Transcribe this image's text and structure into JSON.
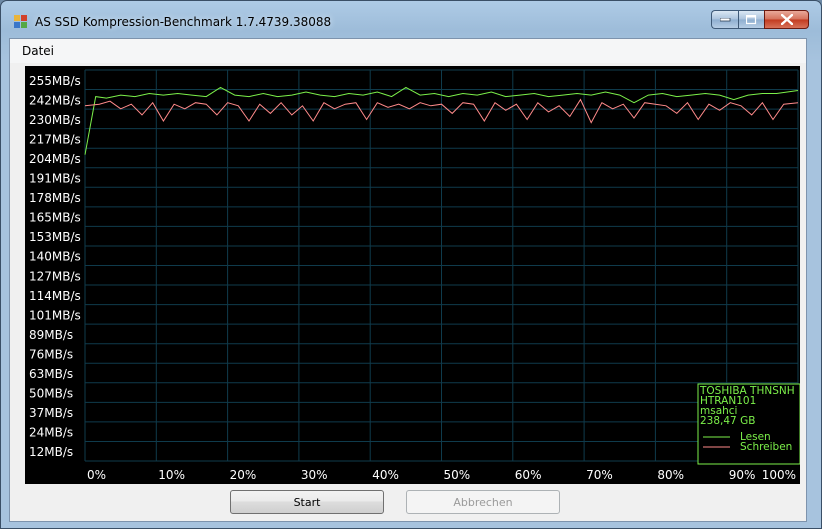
{
  "window": {
    "title": "AS SSD Kompression-Benchmark 1.7.4739.38088"
  },
  "menu": {
    "items": [
      "Datei"
    ]
  },
  "buttons": {
    "start": "Start",
    "cancel": "Abbrechen"
  },
  "colors": {
    "read": "#7cf04a",
    "write": "#ff8a8a",
    "grid": "#0f3b4c",
    "axis_text": "#ffffff",
    "info_text": "#7cf04a"
  },
  "info_box": {
    "lines": [
      "TOSHIBA THNSNH",
      "HTRAN101",
      "msahci",
      "238,47 GB"
    ],
    "legend_read": "Lesen",
    "legend_write": "Schreiben"
  },
  "chart_data": {
    "type": "line",
    "y_tick_labels": [
      "255MB/s",
      "242MB/s",
      "230MB/s",
      "217MB/s",
      "204MB/s",
      "191MB/s",
      "178MB/s",
      "165MB/s",
      "153MB/s",
      "140MB/s",
      "127MB/s",
      "114MB/s",
      "101MB/s",
      "89MB/s",
      "76MB/s",
      "63MB/s",
      "50MB/s",
      "37MB/s",
      "24MB/s",
      "12MB/s"
    ],
    "y_tick_values": [
      255,
      242,
      230,
      217,
      204,
      191,
      178,
      165,
      153,
      140,
      127,
      114,
      101,
      89,
      76,
      63,
      50,
      37,
      24,
      12
    ],
    "x_tick_labels": [
      "0%",
      "10%",
      "20%",
      "30%",
      "40%",
      "50%",
      "60%",
      "70%",
      "80%",
      "90%",
      "100%"
    ],
    "x_tick_values": [
      0,
      10,
      20,
      30,
      40,
      50,
      60,
      70,
      80,
      90,
      100
    ],
    "xlim": [
      0,
      100
    ],
    "ylim": [
      0,
      260
    ],
    "grid": true,
    "legend_position": "bottom-right",
    "series": [
      {
        "name": "Lesen",
        "x": [
          0,
          1.5,
          3,
          5,
          7,
          9,
          11,
          13,
          15,
          17,
          19,
          21,
          23,
          25,
          27,
          29,
          31,
          33,
          35,
          37,
          39,
          41,
          43,
          45,
          47,
          49,
          51,
          53,
          55,
          57,
          59,
          61,
          63,
          65,
          67,
          69,
          71,
          73,
          75,
          77,
          79,
          81,
          83,
          85,
          87,
          89,
          91,
          93,
          95,
          97,
          100
        ],
        "values": [
          206,
          244,
          243,
          245,
          244,
          246,
          245,
          246,
          245,
          244,
          250,
          245,
          244,
          246,
          244,
          245,
          247,
          245,
          244,
          246,
          245,
          247,
          244,
          250,
          245,
          246,
          244,
          246,
          245,
          247,
          244,
          245,
          246,
          244,
          245,
          246,
          245,
          247,
          245,
          240,
          245,
          246,
          244,
          245,
          246,
          245,
          242,
          245,
          246,
          246,
          248
        ]
      },
      {
        "name": "Schreiben",
        "x": [
          0,
          2,
          3.5,
          5,
          6.5,
          8,
          9.5,
          11,
          12.5,
          14,
          15.5,
          17,
          18.5,
          20,
          21.5,
          23,
          24.5,
          26,
          27.5,
          29,
          30.5,
          32,
          33.5,
          35,
          36.5,
          38,
          39.5,
          41,
          42.5,
          44,
          45.5,
          47,
          48.5,
          50,
          51.5,
          53,
          54.5,
          56,
          57.5,
          59,
          60.5,
          62,
          63.5,
          65,
          66.5,
          68,
          69.5,
          71,
          72.5,
          74,
          75.5,
          77,
          78.5,
          80,
          81.5,
          83,
          84.5,
          86,
          87.5,
          89,
          90.5,
          92,
          93.5,
          95,
          96.5,
          98,
          100
        ],
        "values": [
          238,
          239,
          241,
          236,
          239,
          232,
          240,
          228,
          239,
          236,
          240,
          239,
          232,
          240,
          238,
          228,
          239,
          233,
          240,
          232,
          238,
          228,
          240,
          236,
          239,
          240,
          229,
          240,
          237,
          239,
          236,
          240,
          238,
          239,
          233,
          240,
          239,
          228,
          240,
          235,
          239,
          229,
          240,
          234,
          238,
          231,
          242,
          227,
          240,
          236,
          239,
          230,
          240,
          239,
          238,
          233,
          240,
          229,
          239,
          235,
          240,
          238,
          232,
          240,
          229,
          239,
          240
        ]
      }
    ]
  }
}
